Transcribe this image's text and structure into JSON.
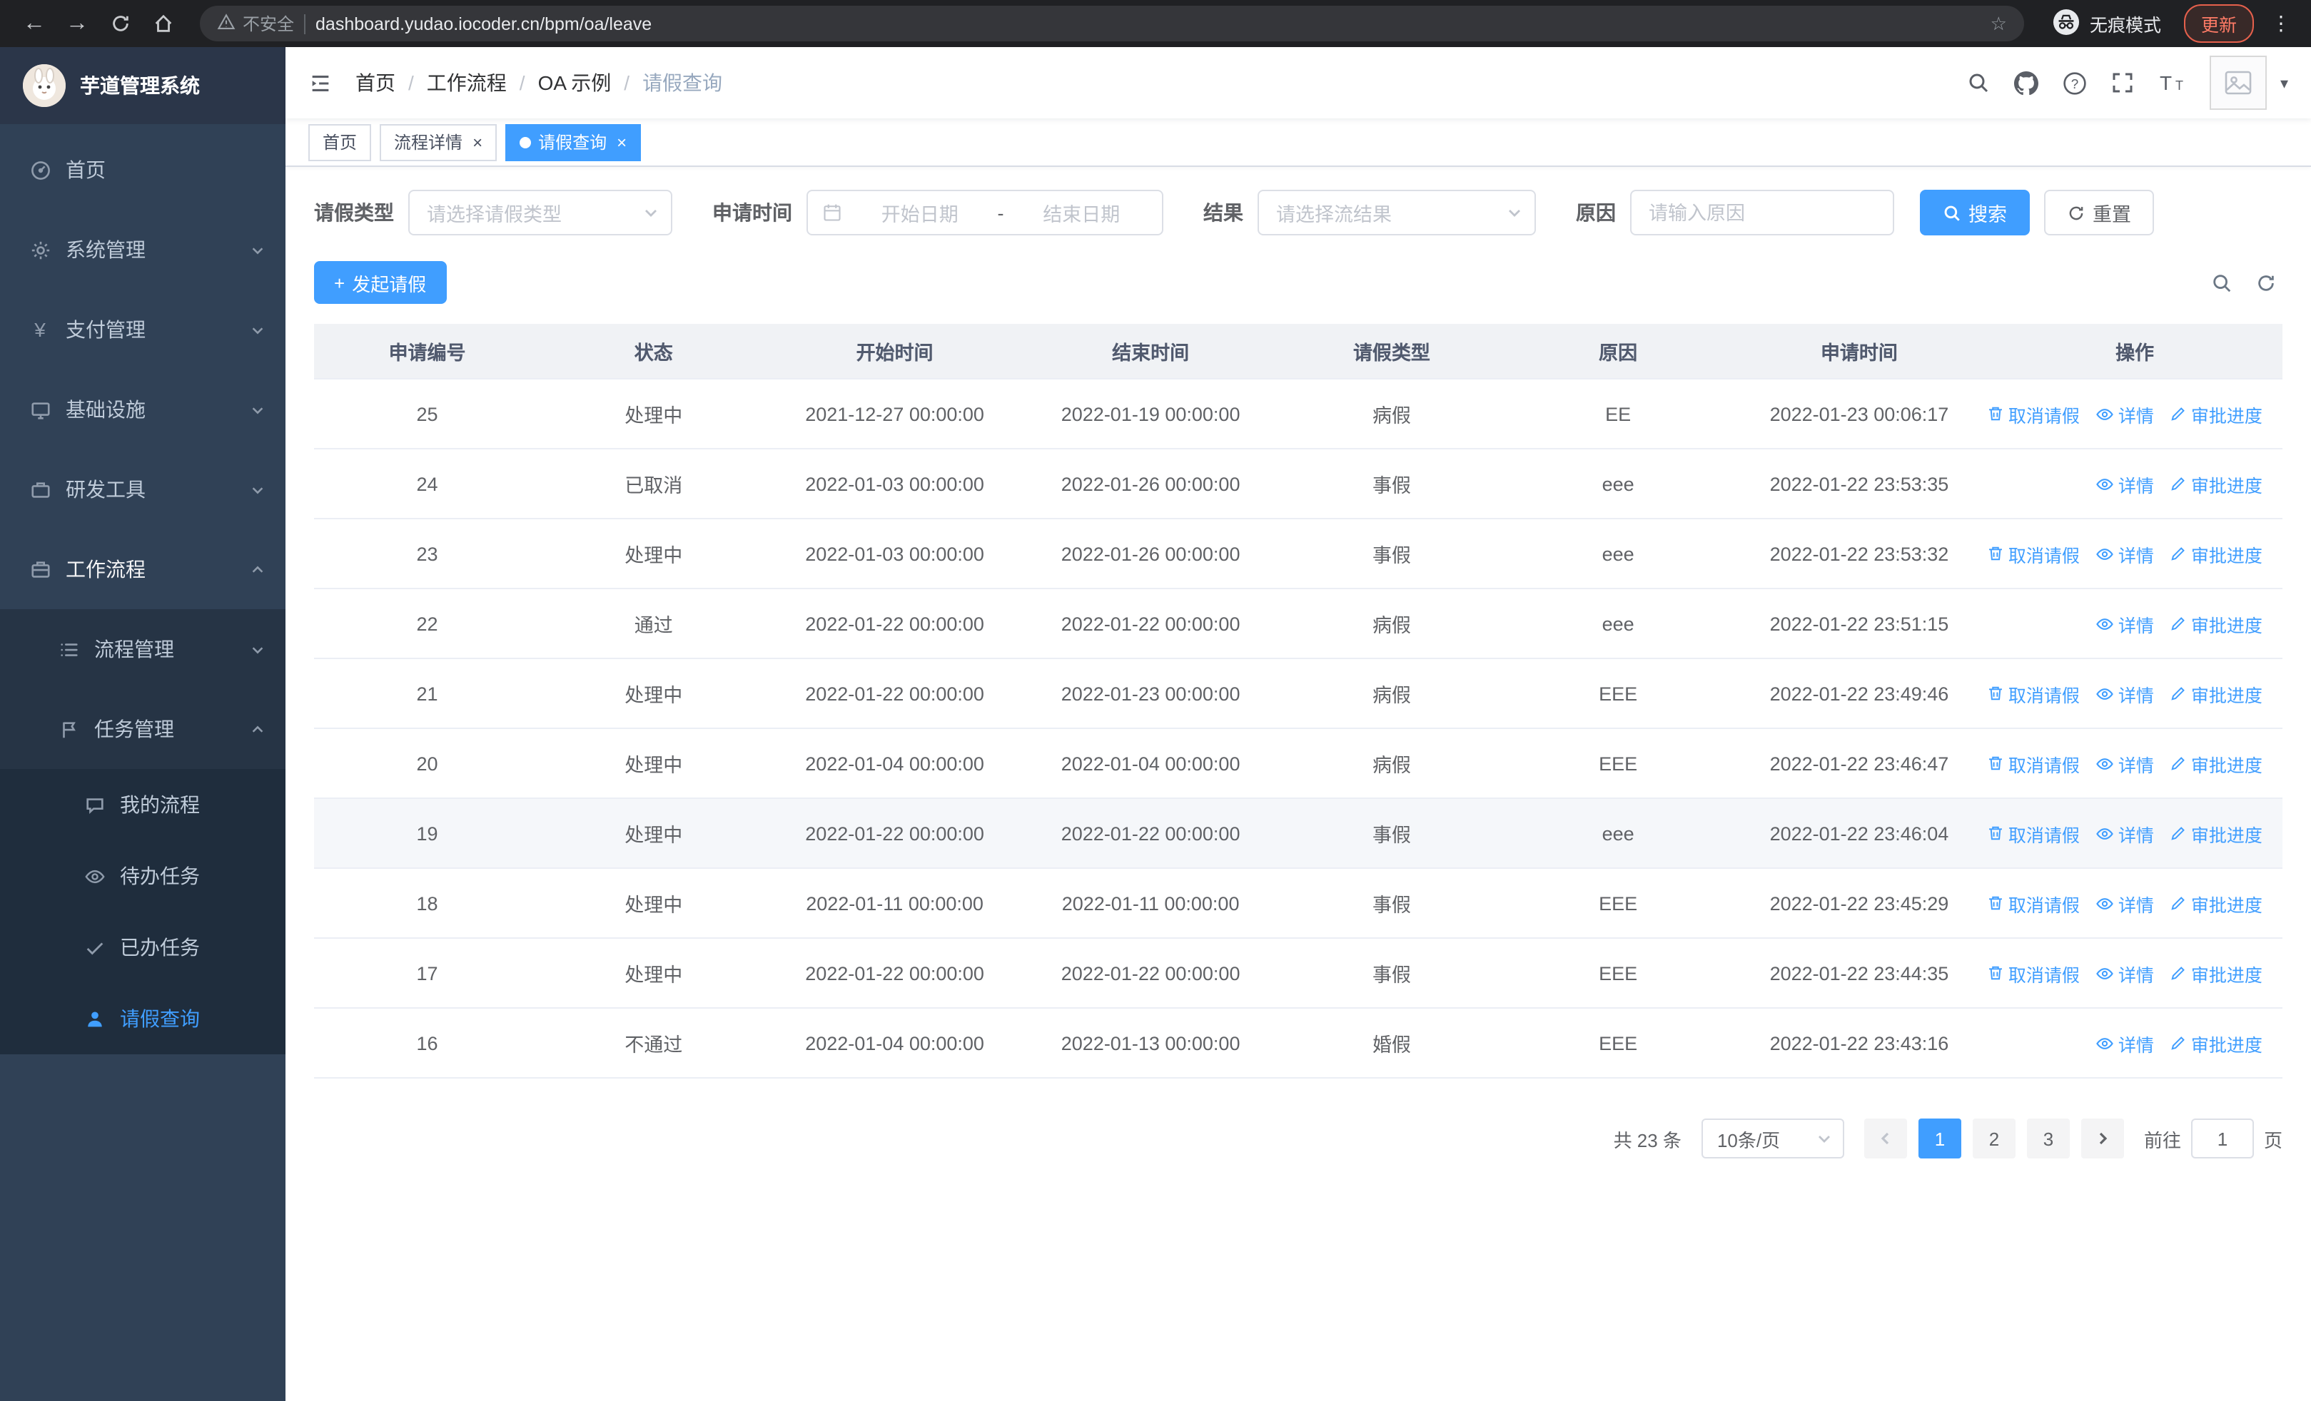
{
  "icons": {
    "back": "←",
    "forward": "→",
    "star": "☆",
    "menu_dots": "⋮",
    "close": "×",
    "plus": "+",
    "yen": "¥",
    "caret_down": "▾",
    "question": "?"
  },
  "browser": {
    "security_label": "不安全",
    "url": "dashboard.yudao.iocoder.cn/bpm/oa/leave",
    "incognito_label": "无痕模式",
    "update_label": "更新"
  },
  "sidebar": {
    "title": "芋道管理系统",
    "items": [
      {
        "label": "首页"
      },
      {
        "label": "系统管理"
      },
      {
        "label": "支付管理"
      },
      {
        "label": "基础设施"
      },
      {
        "label": "研发工具"
      },
      {
        "label": "工作流程"
      },
      {
        "label": "流程管理"
      },
      {
        "label": "任务管理"
      },
      {
        "label": "我的流程"
      },
      {
        "label": "待办任务"
      },
      {
        "label": "已办任务"
      },
      {
        "label": "请假查询"
      }
    ]
  },
  "breadcrumb": {
    "items": [
      "首页",
      "工作流程",
      "OA 示例",
      "请假查询"
    ],
    "separator": "/"
  },
  "tabs": [
    {
      "label": "首页"
    },
    {
      "label": "流程详情"
    },
    {
      "label": "请假查询"
    }
  ],
  "filters": {
    "leave_type_label": "请假类型",
    "leave_type_placeholder": "请选择请假类型",
    "apply_time_label": "申请时间",
    "start_placeholder": "开始日期",
    "date_separator": "-",
    "end_placeholder": "结束日期",
    "result_label": "结果",
    "result_placeholder": "请选择流结果",
    "reason_label": "原因",
    "reason_placeholder": "请输入原因",
    "search_label": "搜索",
    "reset_label": "重置"
  },
  "toolbar": {
    "create_label": "发起请假"
  },
  "table": {
    "columns": [
      "申请编号",
      "状态",
      "开始时间",
      "结束时间",
      "请假类型",
      "原因",
      "申请时间",
      "操作"
    ],
    "op_labels": {
      "cancel": "取消请假",
      "detail": "详情",
      "progress": "审批进度"
    },
    "rows": [
      {
        "id": "25",
        "status": "处理中",
        "start": "2021-12-27 00:00:00",
        "end": "2022-01-19 00:00:00",
        "type": "病假",
        "reason": "EE",
        "apply_time": "2022-01-23 00:06:17",
        "can_cancel": true,
        "highlighted": false
      },
      {
        "id": "24",
        "status": "已取消",
        "start": "2022-01-03 00:00:00",
        "end": "2022-01-26 00:00:00",
        "type": "事假",
        "reason": "eee",
        "apply_time": "2022-01-22 23:53:35",
        "can_cancel": false,
        "highlighted": false
      },
      {
        "id": "23",
        "status": "处理中",
        "start": "2022-01-03 00:00:00",
        "end": "2022-01-26 00:00:00",
        "type": "事假",
        "reason": "eee",
        "apply_time": "2022-01-22 23:53:32",
        "can_cancel": true,
        "highlighted": false
      },
      {
        "id": "22",
        "status": "通过",
        "start": "2022-01-22 00:00:00",
        "end": "2022-01-22 00:00:00",
        "type": "病假",
        "reason": "eee",
        "apply_time": "2022-01-22 23:51:15",
        "can_cancel": false,
        "highlighted": false
      },
      {
        "id": "21",
        "status": "处理中",
        "start": "2022-01-22 00:00:00",
        "end": "2022-01-23 00:00:00",
        "type": "病假",
        "reason": "EEE",
        "apply_time": "2022-01-22 23:49:46",
        "can_cancel": true,
        "highlighted": false
      },
      {
        "id": "20",
        "status": "处理中",
        "start": "2022-01-04 00:00:00",
        "end": "2022-01-04 00:00:00",
        "type": "病假",
        "reason": "EEE",
        "apply_time": "2022-01-22 23:46:47",
        "can_cancel": true,
        "highlighted": false
      },
      {
        "id": "19",
        "status": "处理中",
        "start": "2022-01-22 00:00:00",
        "end": "2022-01-22 00:00:00",
        "type": "事假",
        "reason": "eee",
        "apply_time": "2022-01-22 23:46:04",
        "can_cancel": true,
        "highlighted": true
      },
      {
        "id": "18",
        "status": "处理中",
        "start": "2022-01-11 00:00:00",
        "end": "2022-01-11 00:00:00",
        "type": "事假",
        "reason": "EEE",
        "apply_time": "2022-01-22 23:45:29",
        "can_cancel": true,
        "highlighted": false
      },
      {
        "id": "17",
        "status": "处理中",
        "start": "2022-01-22 00:00:00",
        "end": "2022-01-22 00:00:00",
        "type": "事假",
        "reason": "EEE",
        "apply_time": "2022-01-22 23:44:35",
        "can_cancel": true,
        "highlighted": false
      },
      {
        "id": "16",
        "status": "不通过",
        "start": "2022-01-04 00:00:00",
        "end": "2022-01-13 00:00:00",
        "type": "婚假",
        "reason": "EEE",
        "apply_time": "2022-01-22 23:43:16",
        "can_cancel": false,
        "highlighted": false
      }
    ]
  },
  "pagination": {
    "total_label": "共 23 条",
    "page_size_label": "10条/页",
    "pages": [
      "1",
      "2",
      "3"
    ],
    "active_page": "1",
    "goto_label": "前往",
    "goto_value": "1",
    "page_unit": "页"
  },
  "colors": {
    "accent": "#409eff",
    "sidebar_bg": "#304156",
    "submenu_bg": "#1f2d3d"
  }
}
